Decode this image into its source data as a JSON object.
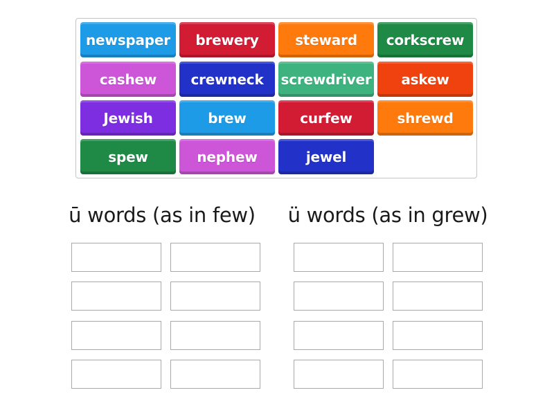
{
  "tiles": [
    {
      "label": "newspaper",
      "color": "#1e9be6"
    },
    {
      "label": "brewery",
      "color": "#d21c34"
    },
    {
      "label": "steward",
      "color": "#ff7a0d"
    },
    {
      "label": "corkscrew",
      "color": "#1e8a45"
    },
    {
      "label": "cashew",
      "color": "#cc55d8"
    },
    {
      "label": "crewneck",
      "color": "#2232c8"
    },
    {
      "label": "screwdriver",
      "color": "#3fb37f"
    },
    {
      "label": "askew",
      "color": "#f0420e"
    },
    {
      "label": "Jewish",
      "color": "#7d2ee0"
    },
    {
      "label": "brew",
      "color": "#1e9be6"
    },
    {
      "label": "curfew",
      "color": "#d21c34"
    },
    {
      "label": "shrewd",
      "color": "#ff7a0d"
    },
    {
      "label": "spew",
      "color": "#1e8a45"
    },
    {
      "label": "nephew",
      "color": "#cc55d8"
    },
    {
      "label": "jewel",
      "color": "#2232c8"
    }
  ],
  "groups": [
    {
      "title": "ū words (as in few)",
      "slot_count": 8
    },
    {
      "title": "ü words (as in grew)",
      "slot_count": 8
    }
  ]
}
